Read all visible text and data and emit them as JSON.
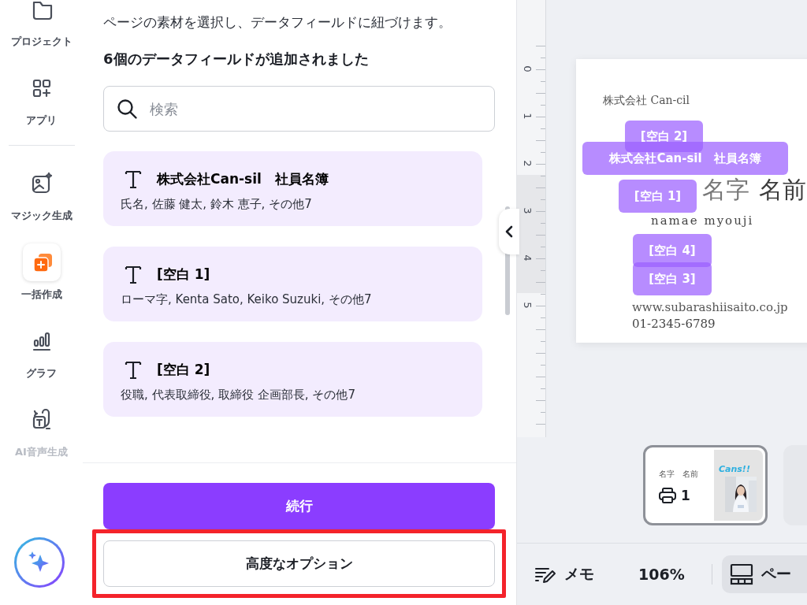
{
  "sidebar": {
    "items": [
      {
        "label": "プロジェクト",
        "kind": "folder",
        "selected": false,
        "disabled": false
      },
      {
        "label": "アプリ",
        "kind": "apps",
        "selected": false,
        "disabled": false
      },
      {
        "label": "マジック生成",
        "kind": "magic",
        "selected": false,
        "disabled": false
      },
      {
        "label": "一括作成",
        "kind": "bulk",
        "selected": true,
        "disabled": false
      },
      {
        "label": "グラフ",
        "kind": "chart",
        "selected": false,
        "disabled": false
      },
      {
        "label": "AI音声生成",
        "kind": "voice",
        "selected": false,
        "disabled": true
      }
    ]
  },
  "panel": {
    "description": "ページの素材を選択し、データフィールドに紐づけます。",
    "heading": "6個のデータフィールドが追加されました",
    "search": {
      "placeholder": "検索"
    },
    "fields": [
      {
        "title": "株式会社Can-sil　社員名簿",
        "values": "氏名, 佐藤 健太, 鈴木 恵子, その他7"
      },
      {
        "title": "[空白 1]",
        "values": "ローマ字, Kenta Sato, Keiko Suzuki, その他7"
      },
      {
        "title": "[空白 2]",
        "values": "役職, 代表取締役, 取締役 企画部長, その他7"
      }
    ],
    "buttons": [
      {
        "label": "続行",
        "kind": "primary",
        "highlighted": false
      },
      {
        "label": "高度なオプション",
        "kind": "secondary",
        "highlighted": true
      }
    ]
  },
  "canvas": {
    "ruler": [
      "0",
      "1",
      "2",
      "3",
      "4",
      "5"
    ],
    "texts": [
      {
        "text": "株式会社 Can-cil",
        "kind": "company"
      },
      {
        "text": "名字",
        "kind": "surname"
      },
      {
        "text": "名前",
        "kind": "given"
      },
      {
        "text": "namae myouji",
        "kind": "roman"
      },
      {
        "text": "www.subarashiisaito.co.jp",
        "kind": "url"
      },
      {
        "text": "01-2345-6789",
        "kind": "phone"
      }
    ],
    "tags": [
      {
        "label": "[空白 2]"
      },
      {
        "label": "株式会社Can-sil　社員名簿"
      },
      {
        "label": "[空白 1]"
      },
      {
        "label": "[空白 4]"
      },
      {
        "label": "[空白 3]"
      }
    ]
  },
  "pages": [
    {
      "number": "1",
      "selected": true,
      "name": "名字　名前",
      "logo": "Cans!!"
    },
    {
      "selected": false
    }
  ],
  "bottom_bar": {
    "notes": "メモ",
    "zoom": "106%",
    "pages": "ペー"
  }
}
